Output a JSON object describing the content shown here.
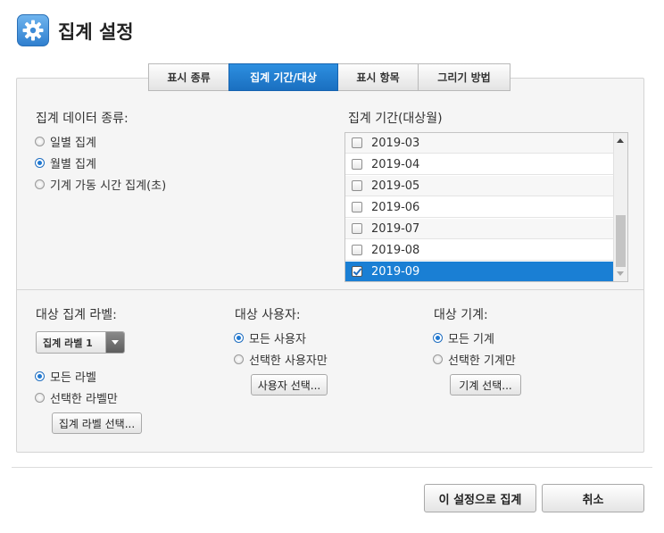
{
  "header": {
    "title": "집계 설정",
    "icon": "gear-icon",
    "accent": "#1a7fd4"
  },
  "tabs": [
    {
      "label": "표시 종류",
      "active": false
    },
    {
      "label": "집계 기간/대상",
      "active": true
    },
    {
      "label": "표시 항목",
      "active": false
    },
    {
      "label": "그리기 방법",
      "active": false
    }
  ],
  "data_type": {
    "label": "집계 데이터 종류:",
    "options": [
      {
        "label": "일별 집계",
        "selected": false
      },
      {
        "label": "월별 집계",
        "selected": true
      },
      {
        "label": "기계 가동 시간 집계(초)",
        "selected": false
      }
    ]
  },
  "period": {
    "label": "집계 기간(대상월)",
    "items": [
      {
        "label": "2019-03",
        "checked": false
      },
      {
        "label": "2019-04",
        "checked": false
      },
      {
        "label": "2019-05",
        "checked": false
      },
      {
        "label": "2019-06",
        "checked": false
      },
      {
        "label": "2019-07",
        "checked": false
      },
      {
        "label": "2019-08",
        "checked": false
      },
      {
        "label": "2019-09",
        "checked": true
      }
    ]
  },
  "labels": {
    "label": "대상 집계 라벨:",
    "select_value": "집계 라벨 1",
    "options": [
      "모든 라벨",
      "선택한 라벨만"
    ],
    "selected_index": 0,
    "button": "집계 라벨 선택..."
  },
  "users": {
    "label": "대상 사용자:",
    "options": [
      "모든 사용자",
      "선택한 사용자만"
    ],
    "selected_index": 0,
    "button": "사용자 선택..."
  },
  "machines": {
    "label": "대상 기계:",
    "options": [
      "모든 기계",
      "선택한 기계만"
    ],
    "selected_index": 0,
    "button": "기계 선택..."
  },
  "footer": {
    "apply": "이 설정으로 집계",
    "cancel": "취소"
  }
}
